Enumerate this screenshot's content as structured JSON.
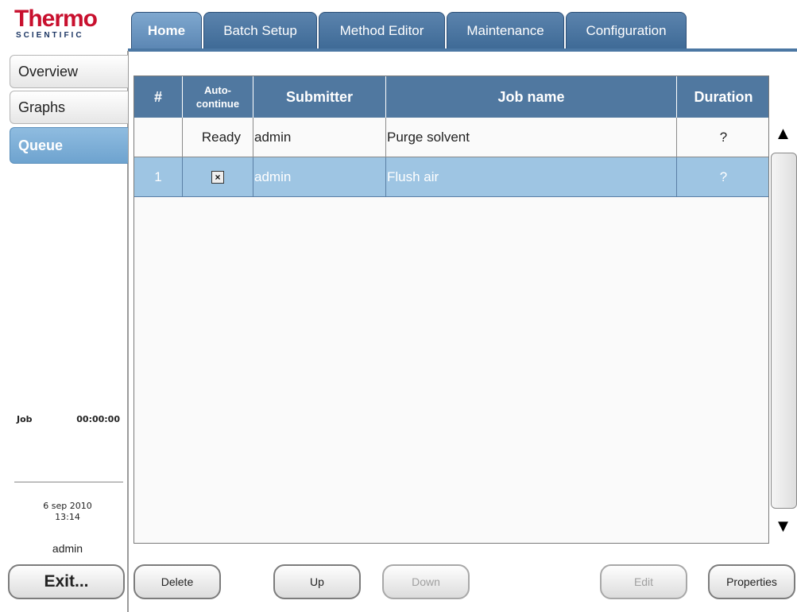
{
  "brand": {
    "line1": "Thermo",
    "line2": "SCIENTIFIC"
  },
  "tabs": [
    {
      "label": "Home",
      "active": true
    },
    {
      "label": "Batch Setup"
    },
    {
      "label": "Method Editor"
    },
    {
      "label": "Maintenance"
    },
    {
      "label": "Configuration"
    }
  ],
  "sidebar": {
    "items": [
      {
        "label": "Overview"
      },
      {
        "label": "Graphs"
      },
      {
        "label": "Queue",
        "active": true
      }
    ],
    "job_label": "Job",
    "job_time": "00:00:00",
    "date": "6 sep 2010",
    "time": "13:14",
    "user": "admin",
    "exit_label": "Exit..."
  },
  "table": {
    "headers": {
      "num": "#",
      "auto1": "Auto-",
      "auto2": "continue",
      "submitter": "Submitter",
      "job_name": "Job name",
      "duration": "Duration"
    },
    "rows": [
      {
        "num": "",
        "auto": "Ready",
        "submitter": "admin",
        "job_name": "Purge solvent",
        "duration": "?"
      },
      {
        "num": "1",
        "auto_checked": true,
        "checkbox": "×",
        "submitter": "admin",
        "job_name": "Flush air",
        "duration": "?"
      }
    ]
  },
  "scroll": {
    "up": "▲",
    "down": "▼"
  },
  "buttons": {
    "delete": "Delete",
    "up": "Up",
    "down": "Down",
    "edit": "Edit",
    "properties": "Properties"
  },
  "colors": {
    "tab": "#4b77a3",
    "selected_row": "#9ec5e3",
    "brand_red": "#c8102e"
  }
}
